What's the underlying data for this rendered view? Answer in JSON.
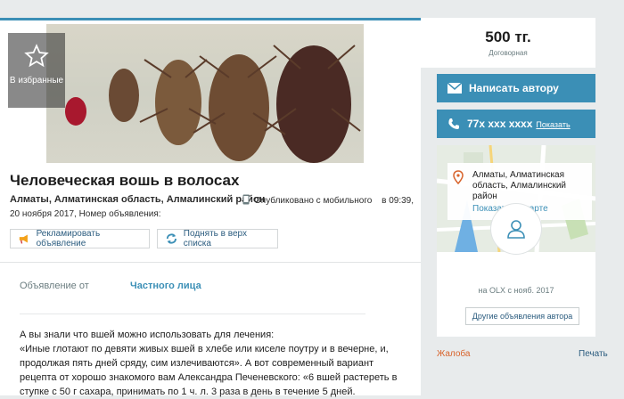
{
  "favorite_label": "В избранные",
  "title": "Человеческая вошь в волосах",
  "location": "Алматы, Алматинская область, Алмалинский район",
  "published_mobile": "Опубликовано с мобильного",
  "published_time": "в 09:39,",
  "published_date_id": "20 ноября 2017, Номер объявления:",
  "promo_button": "Рекламировать объявление",
  "lift_button": "Поднять в верх списка",
  "param_label": "Объявление от",
  "param_value": "Частного лица",
  "description_lines": [
    "А вы знали что вшей можно использовать для лечения:",
    "«Иные глотают по девяти живых вшей в хлебе или киселе поутру и в вечерне, и,",
    "продолжая пять дней сряду, сим излечиваются».     А вот современный вариант",
    "рецепта от хорошо знакомого вам Александра Печеневского: «6 вшей растереть в",
    "ступке с 50 г сахара, принимать по 1 ч. л. 3 раза в день в течение 5 дней."
  ],
  "price": "500 тг.",
  "negotiable": "Договорная",
  "write_author": "Написать автору",
  "phone": "77x xxx xxxx",
  "phone_show": "Показать",
  "address_line1": "Алматы, Алматинская",
  "address_line2": "область, Алмалинский район",
  "show_on_map": "Показать на карте",
  "on_olx_since": "на OLX с нояб. 2017",
  "other_ads": "Другие объявления автора",
  "complain": "Жалоба",
  "print": "Печать",
  "colors": {
    "accent": "#3b8fb6",
    "complain": "#d8632b"
  }
}
